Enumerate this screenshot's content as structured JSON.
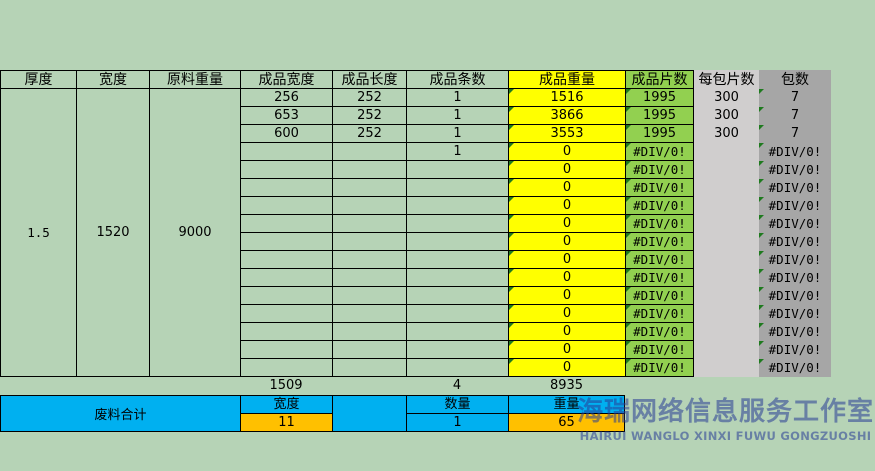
{
  "headers": {
    "thickness": "厚度",
    "width": "宽度",
    "raw_weight": "原料重量",
    "product_width": "成品宽度",
    "product_length": "成品长度",
    "strip_count": "成品条数",
    "product_weight": "成品重量",
    "piece_count": "成品片数",
    "pieces_per_pack": "每包片数",
    "pack_count": "包数"
  },
  "summary": {
    "thickness": "1.5",
    "width": "1520",
    "raw_weight": "9000"
  },
  "rows": [
    {
      "w": "256",
      "l": "252",
      "n": "1",
      "wt": "1516",
      "pcs": "1995",
      "per": "300",
      "packs": "7"
    },
    {
      "w": "653",
      "l": "252",
      "n": "1",
      "wt": "3866",
      "pcs": "1995",
      "per": "300",
      "packs": "7"
    },
    {
      "w": "600",
      "l": "252",
      "n": "1",
      "wt": "3553",
      "pcs": "1995",
      "per": "300",
      "packs": "7"
    },
    {
      "w": "",
      "l": "",
      "n": "1",
      "wt": "0",
      "pcs": "#DIV/0!",
      "per": "",
      "packs": "#DIV/0!"
    },
    {
      "w": "",
      "l": "",
      "n": "",
      "wt": "0",
      "pcs": "#DIV/0!",
      "per": "",
      "packs": "#DIV/0!"
    },
    {
      "w": "",
      "l": "",
      "n": "",
      "wt": "0",
      "pcs": "#DIV/0!",
      "per": "",
      "packs": "#DIV/0!"
    },
    {
      "w": "",
      "l": "",
      "n": "",
      "wt": "0",
      "pcs": "#DIV/0!",
      "per": "",
      "packs": "#DIV/0!"
    },
    {
      "w": "",
      "l": "",
      "n": "",
      "wt": "0",
      "pcs": "#DIV/0!",
      "per": "",
      "packs": "#DIV/0!"
    },
    {
      "w": "",
      "l": "",
      "n": "",
      "wt": "0",
      "pcs": "#DIV/0!",
      "per": "",
      "packs": "#DIV/0!"
    },
    {
      "w": "",
      "l": "",
      "n": "",
      "wt": "0",
      "pcs": "#DIV/0!",
      "per": "",
      "packs": "#DIV/0!"
    },
    {
      "w": "",
      "l": "",
      "n": "",
      "wt": "0",
      "pcs": "#DIV/0!",
      "per": "",
      "packs": "#DIV/0!"
    },
    {
      "w": "",
      "l": "",
      "n": "",
      "wt": "0",
      "pcs": "#DIV/0!",
      "per": "",
      "packs": "#DIV/0!"
    },
    {
      "w": "",
      "l": "",
      "n": "",
      "wt": "0",
      "pcs": "#DIV/0!",
      "per": "",
      "packs": "#DIV/0!"
    },
    {
      "w": "",
      "l": "",
      "n": "",
      "wt": "0",
      "pcs": "#DIV/0!",
      "per": "",
      "packs": "#DIV/0!"
    },
    {
      "w": "",
      "l": "",
      "n": "",
      "wt": "0",
      "pcs": "#DIV/0!",
      "per": "",
      "packs": "#DIV/0!"
    },
    {
      "w": "",
      "l": "",
      "n": "",
      "wt": "0",
      "pcs": "#DIV/0!",
      "per": "",
      "packs": "#DIV/0!"
    }
  ],
  "totals": {
    "width": "1509",
    "strips": "4",
    "weight": "8935"
  },
  "waste": {
    "label": "废料合计",
    "width_label": "宽度",
    "width_value": "11",
    "qty_label": "数量",
    "qty_value": "1",
    "weight_label": "重量",
    "weight_value": "65"
  },
  "watermark": {
    "cn": "海瑞网络信息服务工作室",
    "en": "HAIRUI WANGLO XINXI FUWU GONGZUOSHI"
  },
  "colors": {
    "sheet_bg": "#cce8cc",
    "yellow": "#ffff00",
    "green": "#92d050",
    "blue": "#00b0f0",
    "orange": "#ffc000"
  }
}
